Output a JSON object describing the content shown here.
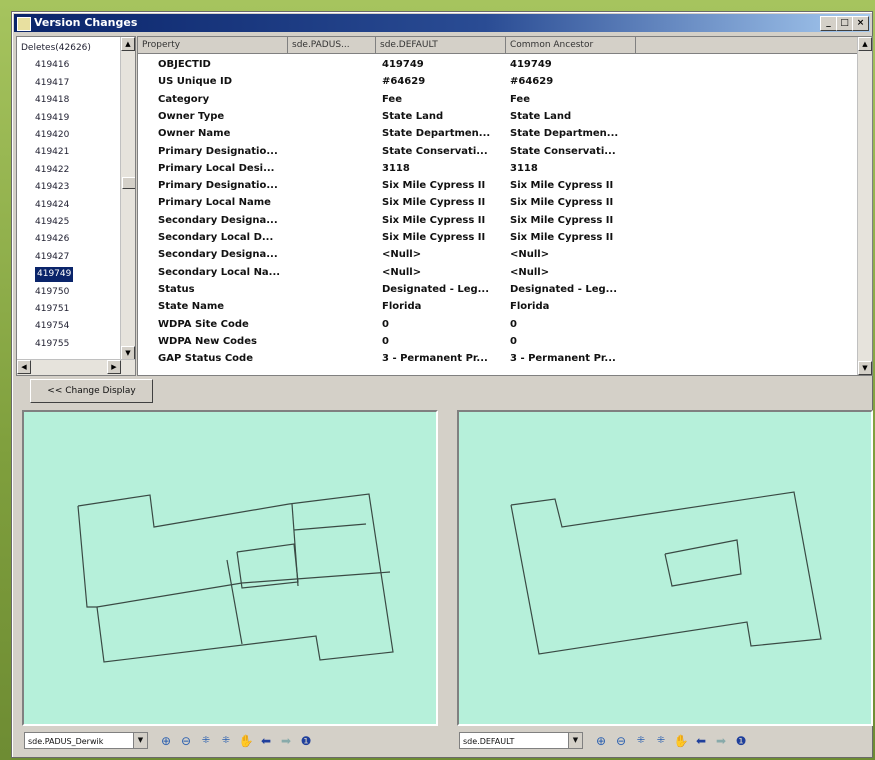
{
  "window": {
    "title": "Version Changes"
  },
  "tree": {
    "items": [
      "Deletes(42626)",
      "419416",
      "419417",
      "419418",
      "419419",
      "419420",
      "419421",
      "419422",
      "419423",
      "419424",
      "419425",
      "419426",
      "419427",
      "419749",
      "419750",
      "419751",
      "419754",
      "419755"
    ],
    "selected": "419749"
  },
  "grid": {
    "headers": [
      "Property",
      "sde.PADUS...",
      "sde.DEFAULT",
      "Common Ancestor"
    ],
    "rows": [
      [
        "OBJECTID",
        "419749",
        "419749"
      ],
      [
        "US Unique ID",
        "#64629",
        "#64629"
      ],
      [
        "Category",
        "Fee",
        "Fee"
      ],
      [
        "Owner Type",
        "State Land",
        "State Land"
      ],
      [
        "Owner Name",
        "State Departmen...",
        "State Departmen..."
      ],
      [
        "Primary Designatio...",
        "State Conservati...",
        "State Conservati..."
      ],
      [
        "Primary Local Desi...",
        "3118",
        "3118"
      ],
      [
        "Primary Designatio...",
        "Six Mile Cypress II",
        "Six Mile Cypress II"
      ],
      [
        "Primary Local Name",
        "Six Mile Cypress II",
        "Six Mile Cypress II"
      ],
      [
        "Secondary Designa...",
        "Six Mile Cypress II",
        "Six Mile Cypress II"
      ],
      [
        "Secondary Local D...",
        "Six Mile Cypress II",
        "Six Mile Cypress II"
      ],
      [
        "Secondary Designa...",
        "<Null>",
        "<Null>"
      ],
      [
        "Secondary Local Na...",
        "<Null>",
        "<Null>"
      ],
      [
        "Status",
        "Designated - Leg...",
        "Designated - Leg..."
      ],
      [
        "State Name",
        "Florida",
        "Florida"
      ],
      [
        "WDPA Site Code",
        "0",
        "0"
      ],
      [
        "WDPA New Codes",
        "0",
        "0"
      ],
      [
        "GAP Status Code",
        "3 - Permanent Pr...",
        "3 - Permanent Pr..."
      ]
    ]
  },
  "change_display_label": "<< Change Display",
  "left_map": {
    "version": "sde.PADUS_Derwik"
  },
  "right_map": {
    "version": "sde.DEFAULT"
  },
  "colors": {
    "map_bg": "#b6f0da",
    "selection": "#0a246a"
  },
  "icons": [
    "zoom-in-icon",
    "zoom-out-icon",
    "fixed-zoom-in-icon",
    "fixed-zoom-out-icon",
    "pan-icon",
    "back-icon",
    "forward-icon",
    "identify-icon"
  ]
}
